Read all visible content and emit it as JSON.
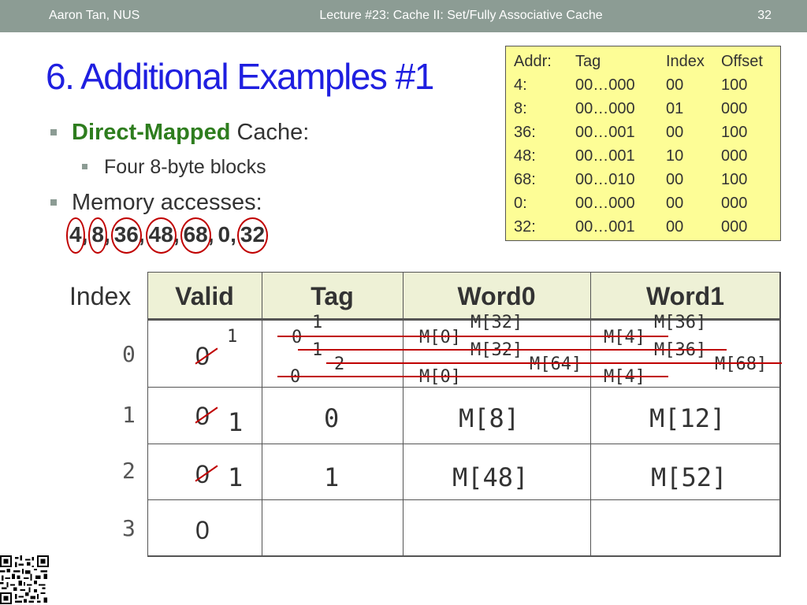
{
  "header": {
    "author": "Aaron Tan, NUS",
    "lecture": "Lecture #23: Cache II: Set/Fully Associative Cache",
    "page": "32"
  },
  "title": "6. Additional Examples #1",
  "bullets": {
    "cache_type": "Direct-Mapped",
    "cache_word": " Cache:",
    "blocks": "Four 8-byte blocks",
    "accesses_label": "Memory accesses:"
  },
  "accesses": [
    "4",
    "8",
    "36",
    "48",
    "68",
    "0",
    "32"
  ],
  "addr_table": {
    "headers": [
      "Addr:",
      "Tag",
      "Index",
      "Offset"
    ],
    "rows": [
      [
        "4:",
        "00…000",
        "00",
        "100"
      ],
      [
        "8:",
        "00…000",
        "01",
        "000"
      ],
      [
        "36:",
        "00…001",
        "00",
        "100"
      ],
      [
        "48:",
        "00…001",
        "10",
        "000"
      ],
      [
        "68:",
        "00…010",
        "00",
        "100"
      ],
      [
        "0:",
        "00…000",
        "00",
        "000"
      ],
      [
        "32:",
        "00…001",
        "00",
        "000"
      ]
    ]
  },
  "cache_table": {
    "index_label": "Index",
    "headers": [
      "Valid",
      "Tag",
      "Word0",
      "Word1"
    ],
    "indices": [
      "0",
      "1",
      "2",
      "3"
    ],
    "row0": {
      "valid_old": "0",
      "valid_new": "1",
      "tag_values": [
        "0",
        "1",
        "1",
        "2",
        "0"
      ],
      "word0_values": [
        "M[0]",
        "M[32]",
        "M[32]",
        "M[64]",
        "M[0]"
      ],
      "word1_values": [
        "M[4]",
        "M[36]",
        "M[36]",
        "M[68]",
        "M[4]"
      ]
    },
    "row1": {
      "valid_old": "0",
      "valid_new": "1",
      "tag": "0",
      "word0": "M[8]",
      "word1": "M[12]"
    },
    "row2": {
      "valid_old": "0",
      "valid_new": "1",
      "tag": "1",
      "word0": "M[48]",
      "word1": "M[52]"
    },
    "row3": {
      "valid": "0"
    }
  },
  "colors": {
    "header_bar": "#8c9c94",
    "title": "#1f1fe0",
    "direct_mapped": "#2e7d1e",
    "annotation_red": "#c00000",
    "addr_table_bg": "#fdfd96",
    "table_header_bg": "#eef1d6"
  },
  "icons": {
    "qr": "qr-code-icon"
  }
}
